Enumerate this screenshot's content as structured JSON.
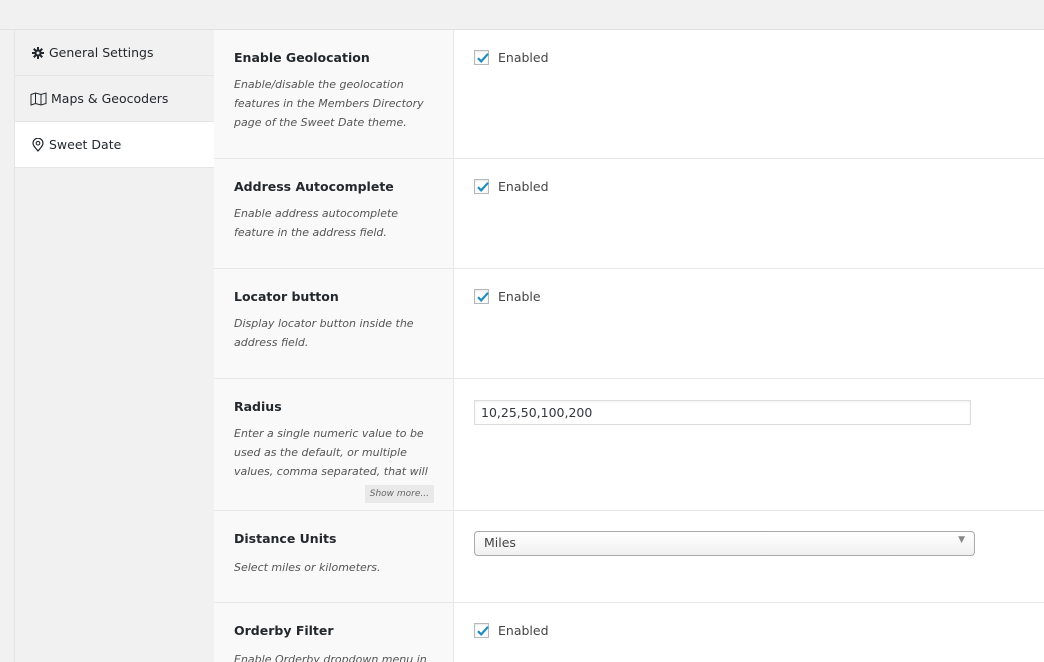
{
  "nav": {
    "items": [
      {
        "label": "General Settings",
        "icon": "gear-icon"
      },
      {
        "label": "Maps & Geocoders",
        "icon": "map-icon"
      },
      {
        "label": "Sweet Date",
        "icon": "location-pin-icon"
      }
    ],
    "active": "Sweet Date"
  },
  "settings": {
    "geolocation": {
      "title": "Enable Geolocation",
      "description": "Enable/disable the geolocation features in the Members Directory page of the Sweet Date theme.",
      "checkbox_label": "Enabled",
      "checked": true
    },
    "autocomplete": {
      "title": "Address Autocomplete",
      "description": "Enable address autocomplete feature in the address field.",
      "checkbox_label": "Enabled",
      "checked": true
    },
    "locator": {
      "title": "Locator button",
      "description": "Display locator button inside the address field.",
      "checkbox_label": "Enable",
      "checked": true
    },
    "radius": {
      "title": "Radius",
      "description": "Enter a single numeric value to be used as the default, or multiple values, comma separated, that will be",
      "show_more": "Show more...",
      "value": "10,25,50,100,200"
    },
    "distance_units": {
      "title": "Distance Units",
      "description": "Select miles or kilometers.",
      "selected": "Miles"
    },
    "orderby": {
      "title": "Orderby Filter",
      "description": "Enable Orderby dropdown menu in",
      "checkbox_label": "Enabled",
      "checked": true
    }
  },
  "colors": {
    "checkmark": "#1e8cbe",
    "nav_bg": "#f1f1f1",
    "panel_bg": "#ffffff"
  }
}
